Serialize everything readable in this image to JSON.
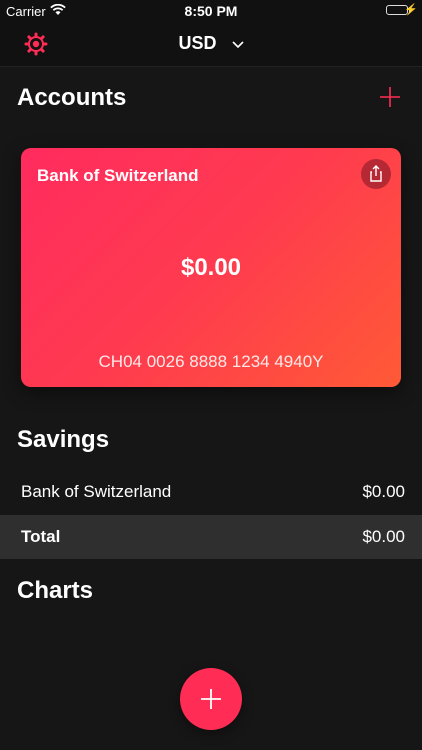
{
  "status_bar": {
    "carrier": "Carrier",
    "time": "8:50 PM"
  },
  "nav": {
    "currency": "USD",
    "settings_icon": "gear-icon",
    "currency_icon": "chevron-down-icon"
  },
  "accounts": {
    "title": "Accounts",
    "add_icon": "plus-icon",
    "card": {
      "bank_name": "Bank of Switzerland",
      "balance": "$0.00",
      "iban": "CH04 0026 8888 1234 4940Y",
      "share_icon": "share-icon"
    }
  },
  "savings": {
    "title": "Savings",
    "rows": [
      {
        "label": "Bank of Switzerland",
        "value": "$0.00"
      }
    ],
    "total": {
      "label": "Total",
      "value": "$0.00"
    }
  },
  "charts": {
    "title": "Charts"
  },
  "fab": {
    "icon": "plus-icon"
  },
  "colors": {
    "accent": "#ff2d55",
    "card_gradient_start": "#ff2b5e",
    "card_gradient_end": "#ff5a36",
    "background": "#161616",
    "total_row": "#2f2f2f"
  }
}
